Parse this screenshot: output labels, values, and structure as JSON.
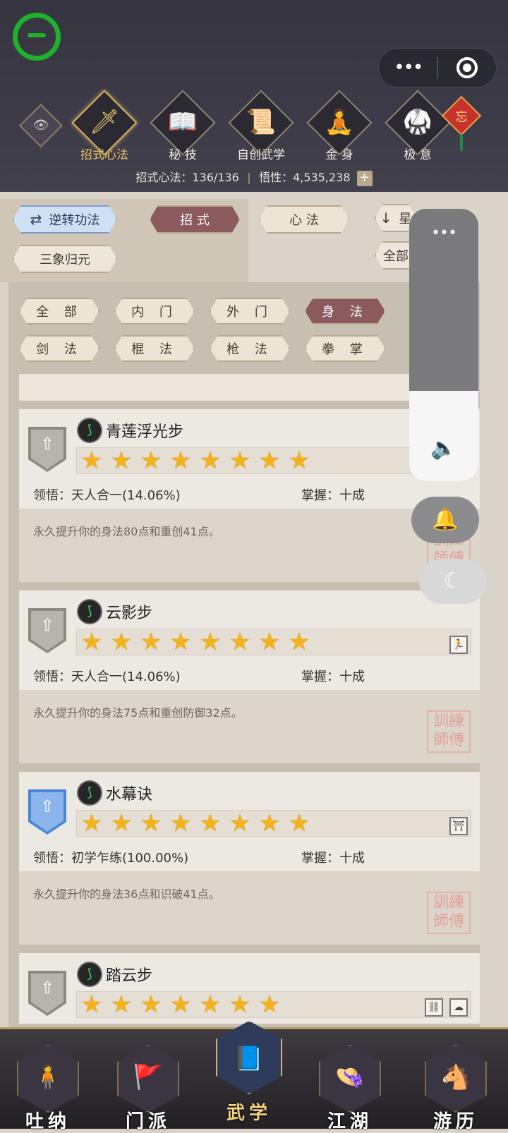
{
  "top_nav": {
    "items": [
      {
        "label": "招式心法",
        "glyph": "🗡",
        "icon": "sword-icon",
        "active": true
      },
      {
        "label": "秘 技",
        "glyph": "📖",
        "icon": "book-icon",
        "active": false
      },
      {
        "label": "自创武学",
        "glyph": "📜",
        "icon": "scroll-icon",
        "active": false
      },
      {
        "label": "金 身",
        "glyph": "🧘",
        "icon": "meditation-icon",
        "active": false
      },
      {
        "label": "极 意",
        "glyph": "🥋",
        "icon": "martial-pose-icon",
        "active": false
      }
    ],
    "knot_char": "忘"
  },
  "stats": {
    "progress": "招式心法：136/136",
    "insight": "悟性：4,535,238",
    "plus": "+"
  },
  "filters": {
    "reverse": "逆转功法",
    "zhaoshi": "招 式",
    "xinfa": "心 法",
    "star": "星",
    "sanxiang": "三象归元",
    "all_right": "全部"
  },
  "tags_row1": [
    "全 部",
    "内 门",
    "外 门",
    "身 法"
  ],
  "tags_row2": [
    "剑 法",
    "棍 法",
    "枪 法",
    "拳 掌"
  ],
  "cards": [
    {
      "name": "青莲浮光步",
      "stars": 8,
      "lingwu": "领悟：天人合一(14.06%)",
      "zhangwo": "掌握：十成",
      "desc": "永久提升你的身法80点和重创41点。",
      "badge": "gray"
    },
    {
      "name": "云影步",
      "stars": 8,
      "lingwu": "领悟：天人合一(14.06%)",
      "zhangwo": "掌握：十成",
      "desc": "永久提升你的身法75点和重创防御32点。",
      "badge": "gray"
    },
    {
      "name": "水幕诀",
      "stars": 8,
      "lingwu": "领悟：初学乍练(100.00%)",
      "zhangwo": "掌握：十成",
      "desc": "永久提升你的身法36点和识破41点。",
      "badge": "blue"
    },
    {
      "name": "踏云步",
      "stars": 7,
      "lingwu": "",
      "zhangwo": "",
      "desc": "",
      "badge": "gray"
    }
  ],
  "seal_text": "訓練\n師傅",
  "bottom_nav": [
    {
      "label": "吐纳",
      "glyph": "🧍",
      "icon": "breathing-figure-icon"
    },
    {
      "label": "门派",
      "glyph": "🚩",
      "icon": "sect-banner-icon"
    },
    {
      "label": "武学",
      "glyph": "📘",
      "icon": "martial-book-icon",
      "active": true
    },
    {
      "label": "江湖",
      "glyph": "👒",
      "icon": "straw-hat-icon"
    },
    {
      "label": "游历",
      "glyph": "🐴",
      "icon": "horse-icon"
    }
  ],
  "overlay": {
    "volume_dots": "•••",
    "speaker": "🔈",
    "bell": "🔔",
    "moon": "☾",
    "volume_level": 0.33
  },
  "capsule": {
    "dots": "•••"
  },
  "colors": {
    "accent_gold": "#e8c26a",
    "active_tag": "#8a5a5e",
    "star": "#f3b31d"
  }
}
